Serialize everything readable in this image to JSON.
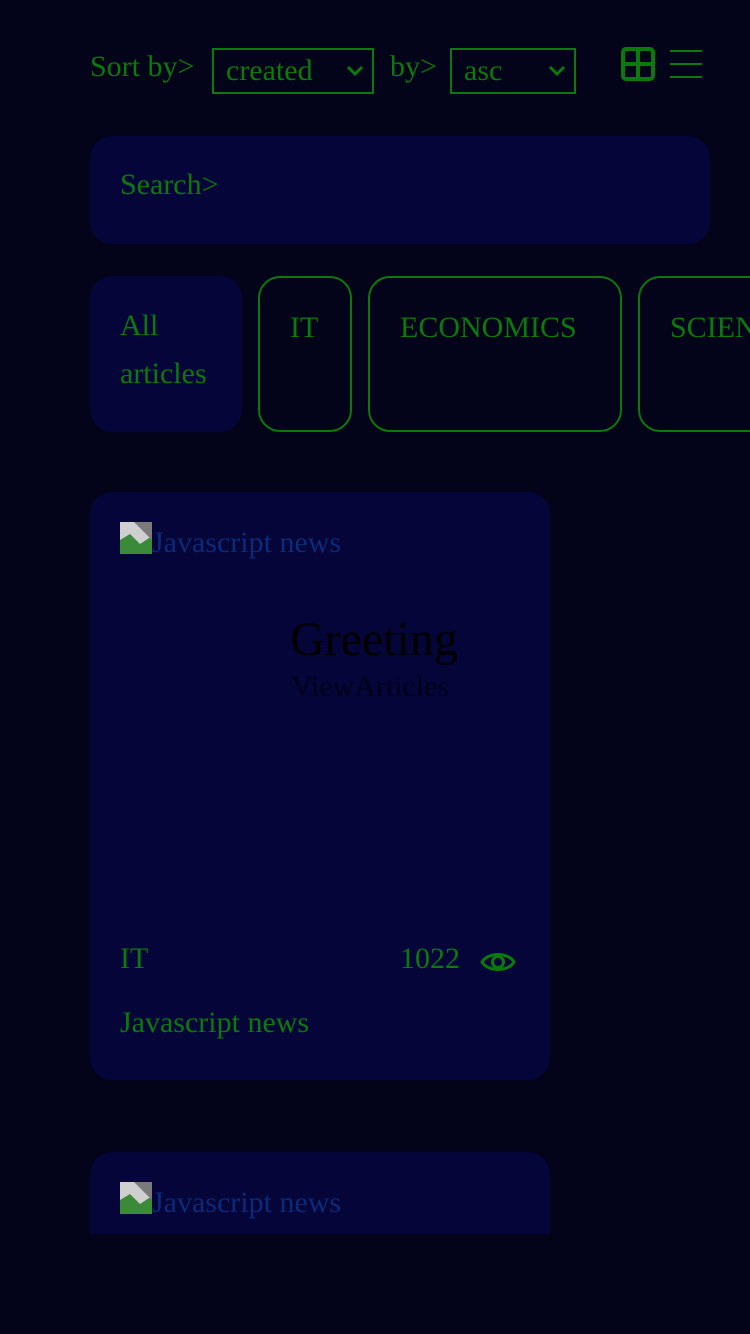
{
  "sort": {
    "sort_by_label": "Sort by>",
    "field_value": "created",
    "order_label": "by>",
    "order_value": "asc"
  },
  "view_toggle": {
    "grid_icon": "grid-view-icon",
    "list_icon": "list-view-icon"
  },
  "search": {
    "placeholder": "Search>"
  },
  "categories": [
    {
      "label": "All articles",
      "active": true
    },
    {
      "label": "IT",
      "active": false
    },
    {
      "label": "ECONOMICS",
      "active": false
    },
    {
      "label": "SCIENCE",
      "active": false
    }
  ],
  "articles": [
    {
      "image_alt": "Javascript news",
      "overlay_title": "Greeting",
      "overlay_subtitle": "ViewArticles",
      "category": "IT",
      "views": "1022",
      "title": "Javascript news"
    },
    {
      "image_alt": "Javascript news"
    }
  ],
  "colors": {
    "background": "#03031a",
    "surface": "#05053a",
    "accent": "#0a7a0a",
    "alt_text": "#0b2a78"
  }
}
